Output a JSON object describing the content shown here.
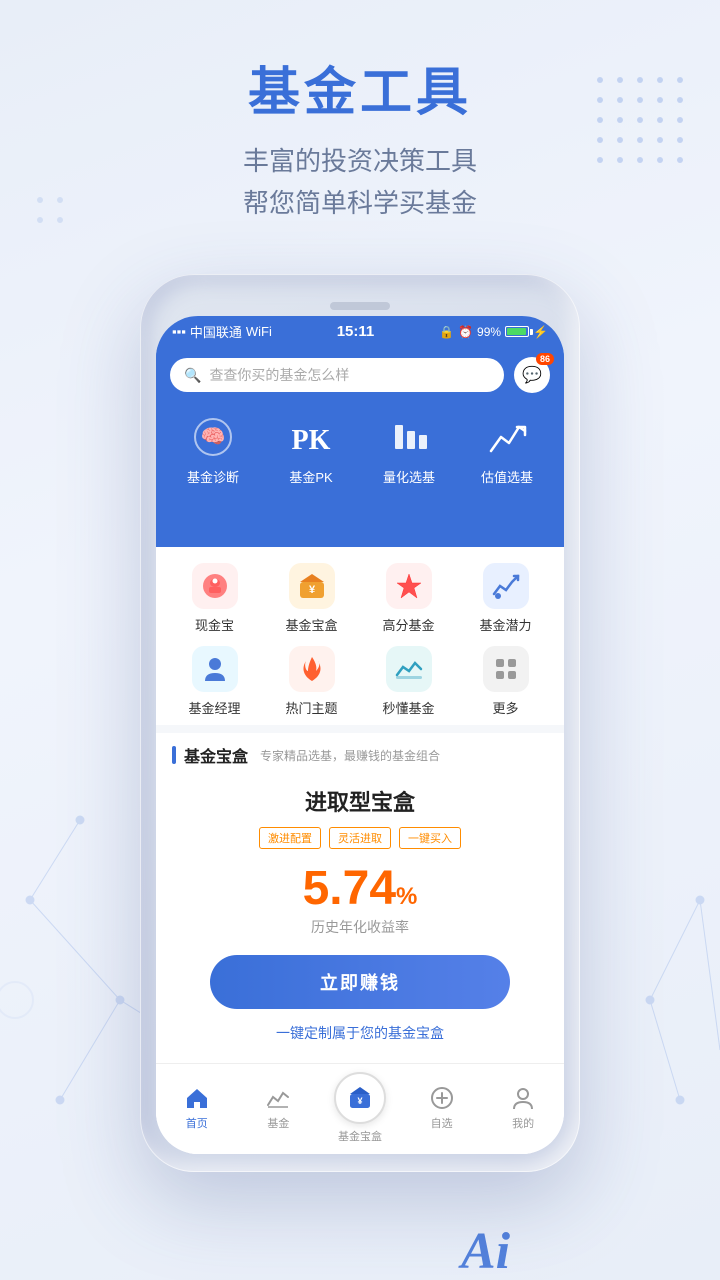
{
  "page": {
    "title": "基金工具",
    "subtitle_line1": "丰富的投资决策工具",
    "subtitle_line2": "帮您简单科学买基金"
  },
  "status_bar": {
    "carrier": "中国联通",
    "time": "15:11",
    "battery_percent": "99%"
  },
  "search": {
    "placeholder": "查查你买的基金怎么样",
    "chat_badge": "86"
  },
  "top_tools": [
    {
      "label": "基金诊断",
      "icon": "🧠"
    },
    {
      "label": "基金PK",
      "icon": "PK"
    },
    {
      "label": "量化选基",
      "icon": "📊"
    },
    {
      "label": "估值选基",
      "icon": "📈"
    }
  ],
  "icon_grid": [
    {
      "label": "现金宝",
      "icon": "🐷",
      "color": "pink"
    },
    {
      "label": "基金宝盒",
      "icon": "💰",
      "color": "orange"
    },
    {
      "label": "高分基金",
      "icon": "⭐",
      "color": "red"
    },
    {
      "label": "基金潜力",
      "icon": "📈",
      "color": "blue"
    },
    {
      "label": "基金经理",
      "icon": "👤",
      "color": "blue"
    },
    {
      "label": "热门主题",
      "icon": "🔥",
      "color": "firebrick"
    },
    {
      "label": "秒懂基金",
      "icon": "📉",
      "color": "teal"
    },
    {
      "label": "更多",
      "icon": "⋮⋮",
      "color": "gray"
    }
  ],
  "section": {
    "title": "基金宝盒",
    "subtitle": "专家精品选基，最赚钱的基金组合"
  },
  "fund_card": {
    "name": "进取型宝盒",
    "tags": [
      "激进配置",
      "灵活进取",
      "一键买入"
    ],
    "rate": "5.74",
    "rate_suffix": "%",
    "rate_label": "历史年化收益率",
    "cta": "立即赚钱",
    "customize": "一键定制属于您的基金宝盒"
  },
  "bottom_nav": [
    {
      "label": "首页",
      "active": true,
      "icon": "home"
    },
    {
      "label": "基金",
      "active": false,
      "icon": "chart"
    },
    {
      "label": "基金宝盒",
      "active": false,
      "icon": "box",
      "special": true
    },
    {
      "label": "自选",
      "active": false,
      "icon": "plus"
    },
    {
      "label": "我的",
      "active": false,
      "icon": "person"
    }
  ]
}
